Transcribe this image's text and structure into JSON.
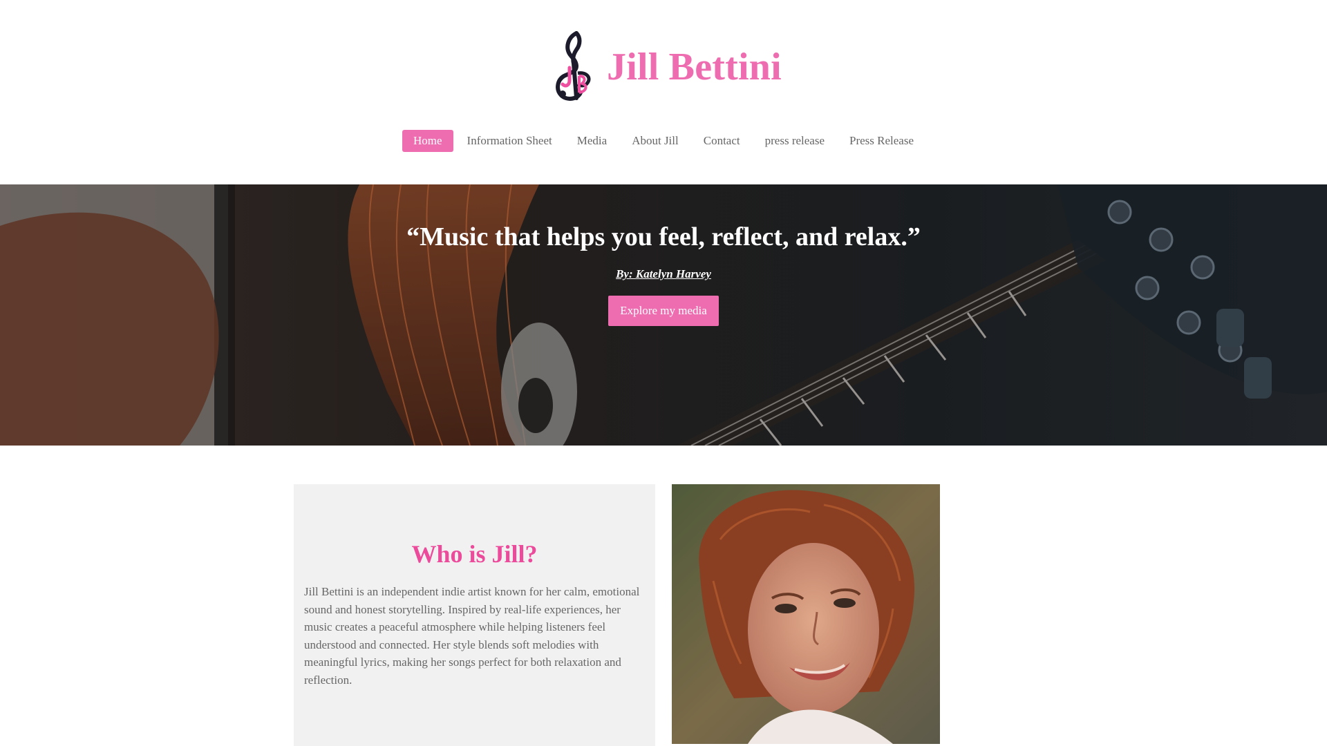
{
  "site": {
    "title": "Jill Bettini",
    "logo_icon": "treble-clef-jb-logo-icon",
    "accent_color": "#ee6db0"
  },
  "nav": {
    "items": [
      {
        "label": "Home",
        "active": true
      },
      {
        "label": "Information Sheet",
        "active": false
      },
      {
        "label": "Media",
        "active": false
      },
      {
        "label": "About Jill",
        "active": false
      },
      {
        "label": "Contact",
        "active": false
      },
      {
        "label": "press release",
        "active": false
      },
      {
        "label": "Press Release",
        "active": false
      }
    ]
  },
  "hero": {
    "quote": "“Music that helps you feel, reflect, and relax.”",
    "byline": "By:  Katelyn Harvey",
    "cta_label": "Explore my media",
    "background_image": "guitar-player-photo"
  },
  "about": {
    "heading": "Who is Jill?",
    "body": "Jill Bettini is an independent indie artist known for her calm, emotional sound and honest storytelling. Inspired by real-life experiences, her music creates a peaceful atmosphere while helping listeners feel understood and connected. Her style blends soft melodies with meaningful lyrics, making her songs perfect for both relaxation and reflection.",
    "portrait_image": "jill-portrait-photo"
  }
}
